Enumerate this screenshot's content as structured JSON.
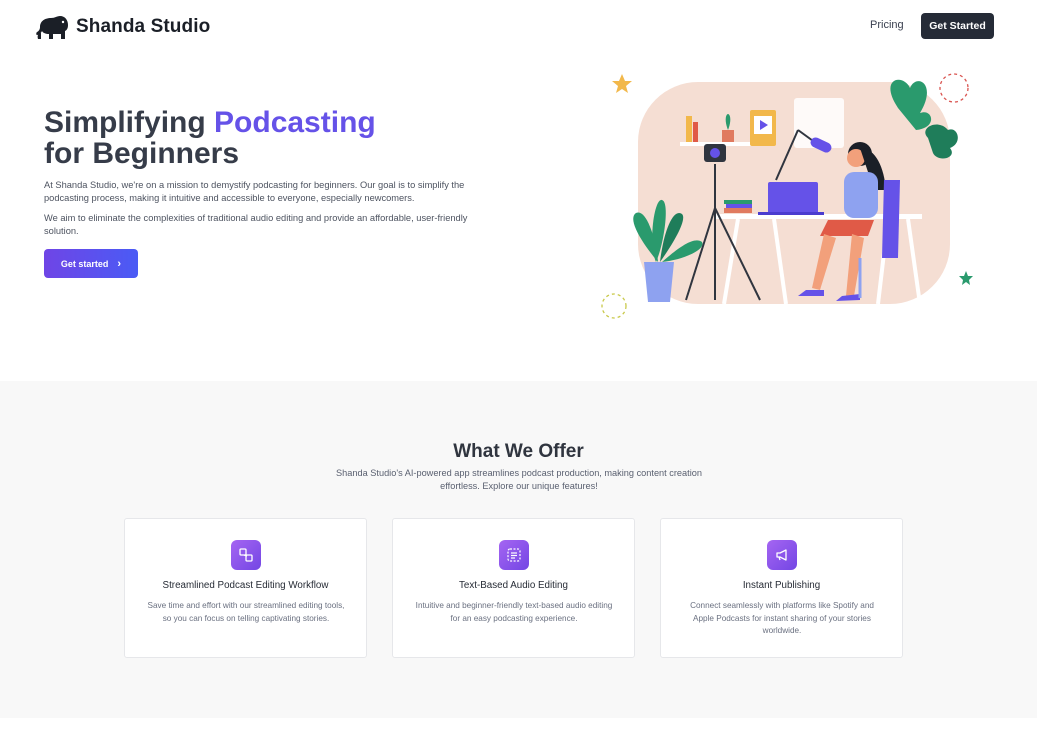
{
  "header": {
    "brand": "Shanda Studio",
    "nav": {
      "pricing": "Pricing",
      "cta": "Get Started"
    }
  },
  "hero": {
    "title_part1": "Simplifying",
    "title_accent": "Podcasting",
    "title_part2": "for Beginners",
    "paragraph1": "At Shanda Studio, we're on a mission to demystify podcasting for beginners. Our goal is to simplify the podcasting process, making it intuitive and accessible to everyone, especially newcomers.",
    "paragraph2": "We aim to eliminate the complexities of traditional audio editing and provide an affordable, user-friendly solution.",
    "button_label": "Get started"
  },
  "offer": {
    "title": "What We Offer",
    "subtitle": "Shanda Studio's AI-powered app streamlines podcast production, making content creation effortless. Explore our unique features!",
    "cards": [
      {
        "title": "Streamlined Podcast Editing Workflow",
        "description": "Save time and effort with our streamlined editing tools, so you can focus on telling captivating stories.",
        "icon": "workflow-icon"
      },
      {
        "title": "Text-Based Audio Editing",
        "description": "Intuitive and beginner-friendly text-based audio editing for an easy podcasting experience.",
        "icon": "text-edit-icon"
      },
      {
        "title": "Instant Publishing",
        "description": "Connect seamlessly with platforms like Spotify and Apple Podcasts for instant sharing of your stories worldwide.",
        "icon": "megaphone-icon"
      }
    ]
  },
  "colors": {
    "accent": "#6552e8",
    "dark_button": "#252b37",
    "section_bg": "#f8f8f8"
  }
}
